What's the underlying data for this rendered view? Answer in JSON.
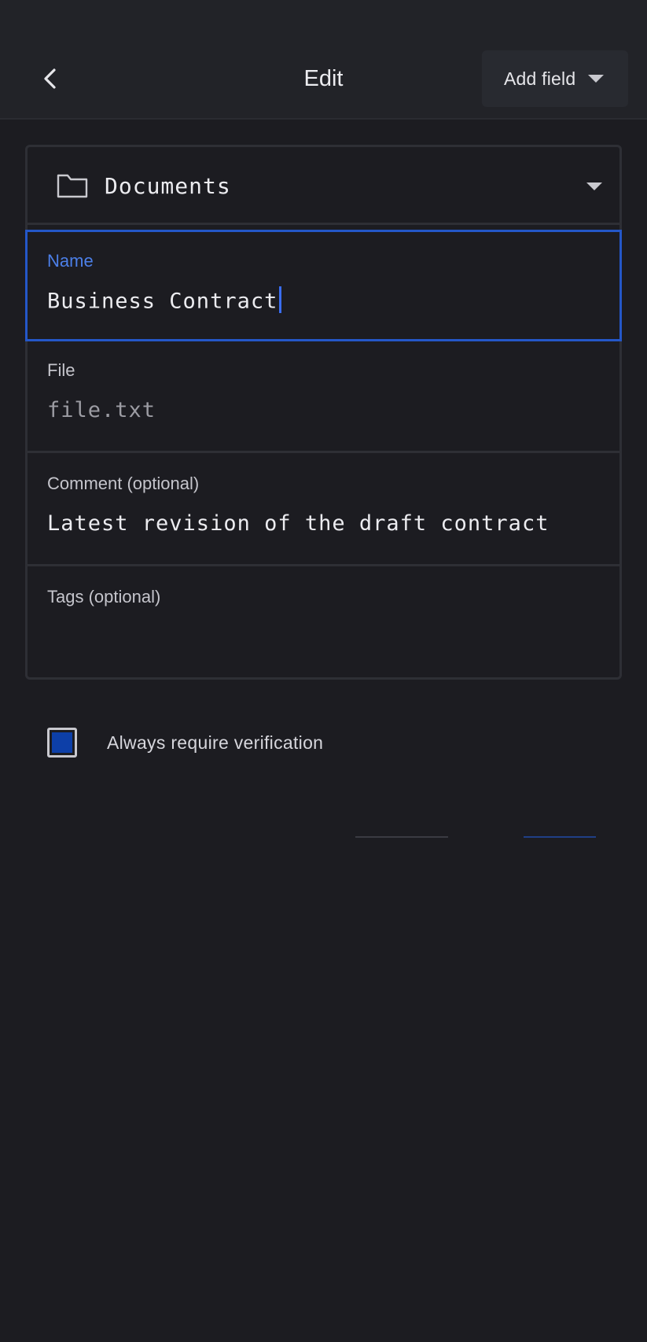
{
  "header": {
    "title": "Edit",
    "back_icon": "chevron-left-icon",
    "add_field_label": "Add field",
    "add_field_icon": "caret-down-icon"
  },
  "form": {
    "folder": {
      "icon": "folder-icon",
      "value": "Documents",
      "dropdown_icon": "caret-down-icon"
    },
    "fields": {
      "name": {
        "label": "Name",
        "value": "Business Contract"
      },
      "file": {
        "label": "File",
        "value": "file.txt"
      },
      "comment": {
        "label": "Comment (optional)",
        "value": "Latest revision of the draft contract"
      },
      "tags": {
        "label": "Tags (optional)",
        "value": ""
      }
    }
  },
  "options": {
    "always_verify_label": "Always require verification",
    "always_verify_checked": true
  },
  "colors": {
    "background": "#1c1c21",
    "header": "#222328",
    "accent": "#2457c8",
    "accent_text": "#4c7fe8",
    "checkbox_fill": "#0d3fa8"
  }
}
